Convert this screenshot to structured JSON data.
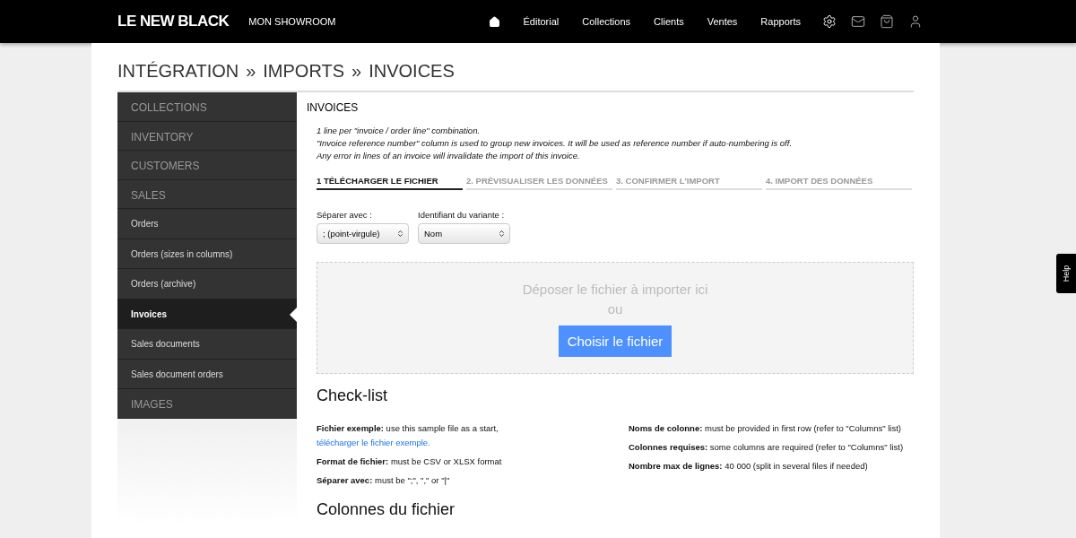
{
  "topbar": {
    "logo": "LE NEW BLACK",
    "showroom": "MON SHOWROOM",
    "nav": [
      "Éditorial",
      "Collections",
      "Clients",
      "Ventes",
      "Rapports"
    ]
  },
  "breadcrumb": [
    "INTÉGRATION",
    "»",
    "IMPORTS",
    "»",
    "INVOICES"
  ],
  "sidebar": {
    "items": [
      {
        "label": "COLLECTIONS",
        "kind": "section",
        "selected": false
      },
      {
        "label": "INVENTORY",
        "kind": "section",
        "selected": false
      },
      {
        "label": "CUSTOMERS",
        "kind": "section",
        "selected": false
      },
      {
        "label": "SALES",
        "kind": "section",
        "selected": false
      },
      {
        "label": "Orders",
        "kind": "item",
        "selected": false
      },
      {
        "label": "Orders (sizes in columns)",
        "kind": "item",
        "selected": false
      },
      {
        "label": "Orders (archive)",
        "kind": "item",
        "selected": false
      },
      {
        "label": "Invoices",
        "kind": "item",
        "selected": true
      },
      {
        "label": "Sales documents",
        "kind": "item",
        "selected": false
      },
      {
        "label": "Sales document orders",
        "kind": "item",
        "selected": false
      },
      {
        "label": "IMAGES",
        "kind": "section",
        "selected": false
      }
    ]
  },
  "main": {
    "title": "INVOICES",
    "notes": [
      "1 line per \"invoice / order line\" combination.",
      "\"Invoice reference number\" column is used to group new invoices. It will be used as reference number if auto-numbering is off.",
      "Any error in lines of an invoice will invalidate the import of this invoice."
    ],
    "steps": [
      {
        "label": "1 TÉLÉCHARGER LE FICHIER",
        "selected": true
      },
      {
        "label": "2. PRÉVISUALISER LES DONNÉES",
        "selected": false
      },
      {
        "label": "3. CONFIRMER L'IMPORT",
        "selected": false
      },
      {
        "label": "4. IMPORT DES DONNÉES",
        "selected": false
      }
    ],
    "fields": [
      {
        "label": "Séparer avec :",
        "value": "; (point-virgule)"
      },
      {
        "label": "Identifiant du variante :",
        "value": "Nom"
      }
    ],
    "dropzone": {
      "text": "Déposer le fichier à importer ici",
      "or": "ou",
      "button": "Choisir le fichier"
    },
    "checklist": {
      "title": "Check-list",
      "left": [
        {
          "text": "**Fichier exemple:** use this sample file as a start,",
          "link": "télécharger le fichier exemple."
        },
        {
          "text": "**Format de fichier:** must be CSV or XLSX format"
        },
        {
          "text": "**Séparer avec:** must be \";\", \",\" or \"|\""
        }
      ],
      "right": [
        {
          "text": "**Noms de colonne:** must be provided in first row (refer to \"Columns\" list)"
        },
        {
          "text": "**Colonnes requises:** some columns are required (refer to \"Columns\" list)"
        },
        {
          "text": "**Nombre max de lignes:** 40 000 (split in several files if needed)"
        }
      ]
    },
    "columns_title": "Colonnes du fichier"
  },
  "help_tab": "Help"
}
